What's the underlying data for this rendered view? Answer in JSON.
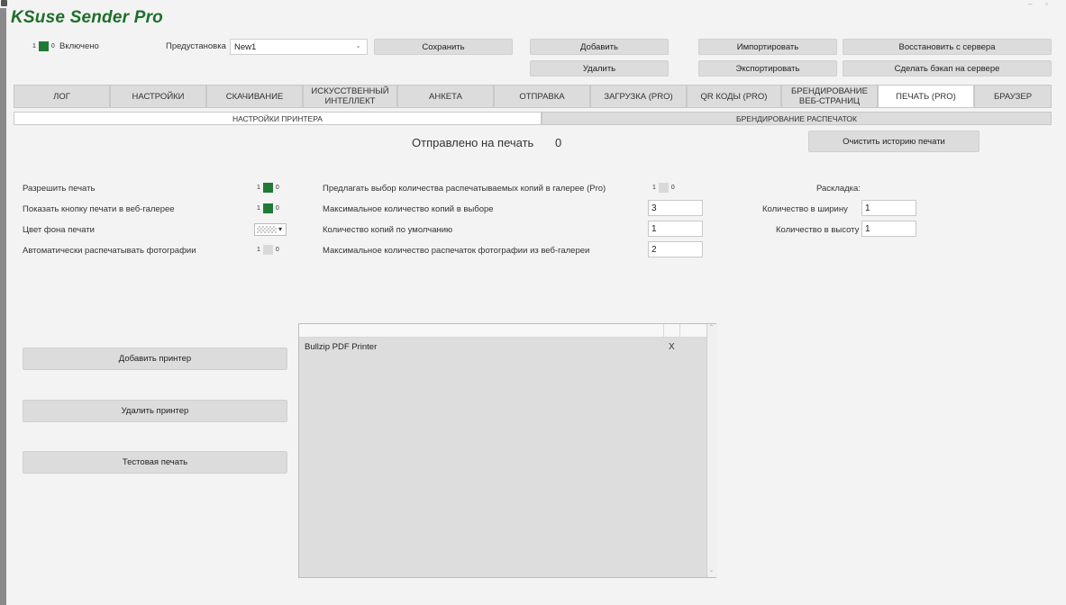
{
  "window": {
    "controls": [
      "–",
      "▫"
    ]
  },
  "app": {
    "title": "KSuse Sender Pro"
  },
  "header": {
    "enabled_on": "1",
    "enabled_off": "0",
    "enabled_label": "Включено",
    "preset_label": "Предустановка",
    "preset_value": "New1",
    "save_label": "Сохранить",
    "add_label": "Добавить",
    "delete_label": "Удалить",
    "import_label": "Импортировать",
    "export_label": "Экспортировать",
    "restore_label": "Восстановить с сервера",
    "backup_label": "Сделать бэкап на сервере"
  },
  "tabs": [
    {
      "label": "ЛОГ"
    },
    {
      "label": "НАСТРОЙКИ"
    },
    {
      "label": "СКАЧИВАНИЕ"
    },
    {
      "label": "ИСКУССТВЕННЫЙ ИНТЕЛЛЕКТ"
    },
    {
      "label": "АНКЕТА"
    },
    {
      "label": "ОТПРАВКА"
    },
    {
      "label": "ЗАГРУЗКА (PRO)"
    },
    {
      "label": "QR КОДЫ (PRO)"
    },
    {
      "label": "БРЕНДИРОВАНИЕ ВЕБ-СТРАНИЦ"
    },
    {
      "label": "ПЕЧАТЬ (PRO)"
    },
    {
      "label": "БРАУЗЕР"
    }
  ],
  "active_tab": "ПЕЧАТЬ (PRO)",
  "subtabs": [
    {
      "label": "НАСТРОЙКИ ПРИНТЕРА"
    },
    {
      "label": "БРЕНДИРОВАНИЕ РАСПЕЧАТОК"
    }
  ],
  "print": {
    "sent_label": "Отправлено на печать",
    "sent_count": "0",
    "clear_history_label": "Очистить историю печати",
    "allow_print_label": "Разрешить печать",
    "show_button_label": "Показать кнопку печати в веб-галерее",
    "bg_color_label": "Цвет фона печати",
    "auto_print_label": "Автоматически распечатывать фотографии",
    "offer_copies_label": "Предлагать выбор количества распечатываемых копий в галерее (Pro)",
    "max_copies_label": "Максимальное количество копий в выборе",
    "max_copies_value": "3",
    "default_copies_label": "Количество копий по умолчанию",
    "default_copies_value": "1",
    "max_prints_label": "Максимальное количество распечаток фотографии из веб-галереи",
    "max_prints_value": "2",
    "layout_label": "Раскладка:",
    "width_count_label": "Количество в ширину",
    "width_count_value": "1",
    "height_count_label": "Количество в высоту",
    "height_count_value": "1",
    "toggle_on": "1",
    "toggle_off": "0"
  },
  "printers": {
    "add_label": "Добавить принтер",
    "remove_label": "Удалить принтер",
    "test_label": "Тестовая печать",
    "list": [
      {
        "name": "Bullzip PDF Printer",
        "remove": "X"
      }
    ]
  },
  "colors": {
    "brand": "#1e6e2a",
    "toggle_on": "#1f7a36"
  }
}
